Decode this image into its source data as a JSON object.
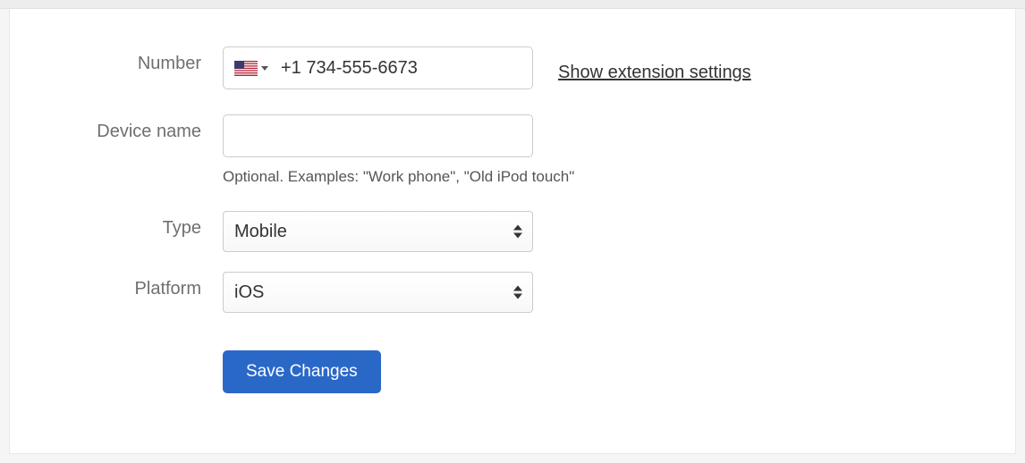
{
  "labels": {
    "number": "Number",
    "device_name": "Device name",
    "type": "Type",
    "platform": "Platform"
  },
  "phone": {
    "value": "+1 734-555-6673",
    "country": "us"
  },
  "extension_link": "Show extension settings",
  "device_name": {
    "value": "",
    "help": "Optional. Examples: \"Work phone\", \"Old iPod touch\""
  },
  "type": {
    "value": "Mobile"
  },
  "platform": {
    "value": "iOS"
  },
  "buttons": {
    "save": "Save Changes"
  }
}
